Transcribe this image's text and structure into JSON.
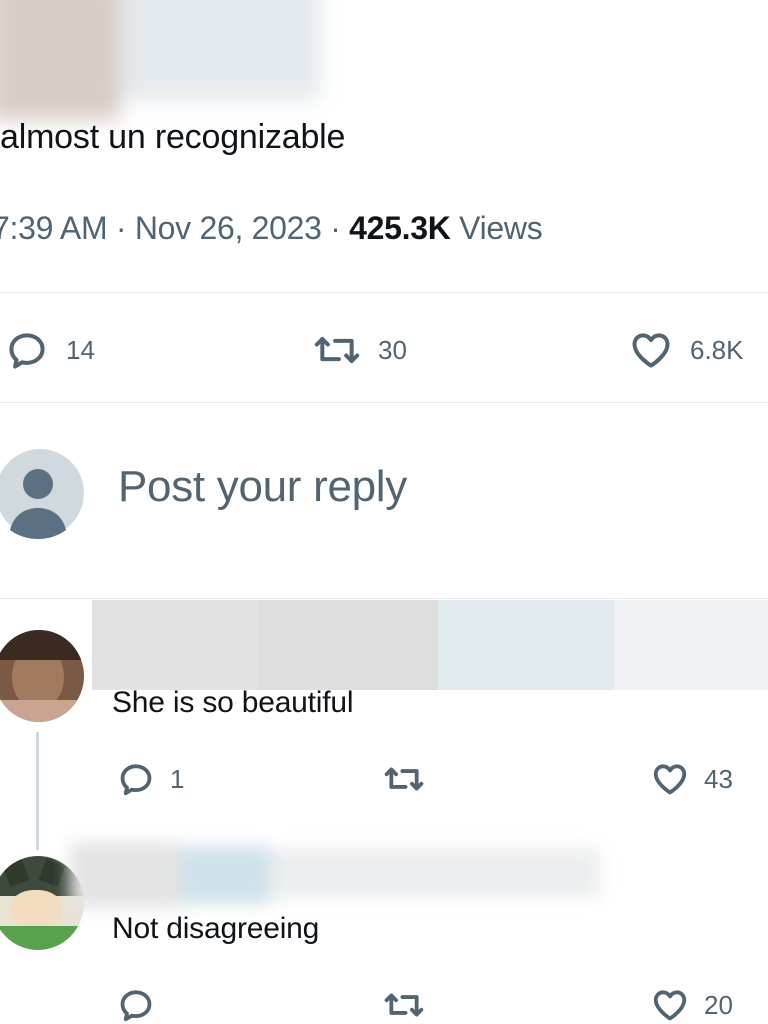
{
  "tweet": {
    "text": "almost un recognizable",
    "time": "7:39 AM",
    "date": "Nov 26, 2023",
    "views_count": "425.3K",
    "views_label": "Views",
    "replies": "14",
    "reposts": "30",
    "likes": "6.8K"
  },
  "composer": {
    "placeholder": "Post your reply"
  },
  "replies": [
    {
      "text": "She is so beautiful",
      "replies": "1",
      "reposts": "",
      "likes": "43"
    },
    {
      "text": "Not disagreeing",
      "replies": "",
      "reposts": "",
      "likes": "20"
    }
  ],
  "icons": {
    "reply": "speech-bubble-icon",
    "repost": "repost-arrows-icon",
    "like": "heart-icon",
    "avatar": "default-avatar-icon"
  },
  "colors": {
    "text": "#0f1419",
    "secondary": "#536471",
    "divider": "#e6e9eb",
    "avatar_bg": "#cfd9de",
    "avatar_fg": "#5b7083"
  }
}
